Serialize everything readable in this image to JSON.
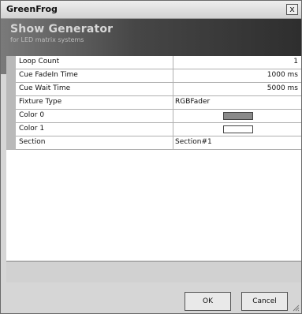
{
  "window": {
    "title": "GreenFrog",
    "close_glyph": "x"
  },
  "header": {
    "title": "Show Generator",
    "subtitle": "for LED matrix systems"
  },
  "properties": [
    {
      "name": "Loop Count",
      "value": "1",
      "align": "right"
    },
    {
      "name": "Cue FadeIn Time",
      "value": "1000 ms",
      "align": "right"
    },
    {
      "name": "Cue Wait Time",
      "value": "5000 ms",
      "align": "right"
    },
    {
      "name": "Fixture Type",
      "value": "RGBFader",
      "align": "left"
    },
    {
      "name": "Color 0",
      "value": "",
      "swatch": "#8a8a8a"
    },
    {
      "name": "Color 1",
      "value": "",
      "swatch": "#ffffff"
    },
    {
      "name": "Section",
      "value": "Section#1",
      "align": "left"
    }
  ],
  "buttons": {
    "ok_label": "OK",
    "cancel_label": "Cancel"
  },
  "icons": {
    "close": "close-icon",
    "resize": "resize-grip-icon"
  }
}
